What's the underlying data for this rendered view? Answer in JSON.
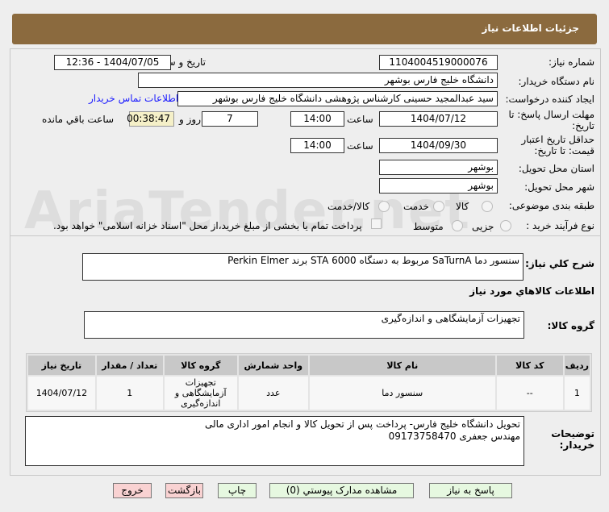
{
  "header": {
    "title": "جزئیات اطلاعات نیاز"
  },
  "form": {
    "need_number_label": "شماره نیاز:",
    "need_number": "1104004519000076",
    "announce_label": "تاریخ و ساعت اعلان عمومی:",
    "announce_value": "1404/07/05 - 12:36",
    "buyer_label": "نام دستگاه خریدار:",
    "buyer": "دانشگاه خلیج فارس بوشهر",
    "requester_label": "ایجاد کننده درخواست:",
    "requester": "سید عبدالمجید  حسینی کارشناس پژوهشی دانشگاه خلیج فارس بوشهر",
    "contact_link": "اطلاعات تماس خریدار",
    "deadline_label": "مهلت ارسال پاسخ: تا تاریخ:",
    "deadline_date": "1404/07/12",
    "time_label": "ساعت",
    "deadline_time": "14:00",
    "days": "7",
    "days_label": "روز و",
    "remaining": "00:38:47",
    "remaining_label": "ساعت باقي مانده",
    "validity_label": "حداقل تاریخ اعتبار قیمت: تا تاریخ:",
    "validity_date": "1404/09/30",
    "validity_time": "14:00",
    "province_label": "استان محل تحویل:",
    "province": "بوشهر",
    "city_label": "شهر محل تحویل:",
    "city": "بوشهر",
    "category_label": "طبقه بندی موضوعی:",
    "category_options": [
      "کالا",
      "خدمت",
      "کالا/خدمت"
    ],
    "process_label": "نوع فرآیند خرید :",
    "process_options": [
      "جزیی",
      "متوسط"
    ],
    "payment_note": "پرداخت تمام یا بخشی از مبلغ خرید،از محل \"اسناد خزانه اسلامی\" خواهد بود."
  },
  "description": {
    "label": "شرح كلي نياز:",
    "value": "سنسور دما SaTurnA مربوط به دستگاه STA 6000 برند Perkin Elmer"
  },
  "goods": {
    "section_title": "اطلاعات كالاهاي مورد نياز",
    "group_label": "گروه كالا:",
    "group_value": "تجهیزات آزمایشگاهی و اندازه‌گیری"
  },
  "table": {
    "headers": [
      "رديف",
      "كد كالا",
      "نام كالا",
      "واحد شمارش",
      "گروه كالا",
      "تعداد / مقدار",
      "تاريخ نياز"
    ],
    "rows": [
      [
        "1",
        "--",
        "سنسور دما",
        "عدد",
        "تجهیزات آزمایشگاهی و اندازه‌گیری",
        "1",
        "1404/07/12"
      ]
    ]
  },
  "notes": {
    "label": "توضیحات خریدار:",
    "line1": "تحویل دانشگاه خلیج فارس- پرداخت پس از تحویل کالا و انجام امور اداری مالی",
    "line2": "مهندس جعفری 09173758470"
  },
  "buttons": {
    "reply": "پاسخ به نیاز",
    "attachments": "مشاهده مدارک پیوستي (0)",
    "print": "چاپ",
    "back": "بازگشت",
    "exit": "خروج"
  },
  "watermark": "AriaTender.net"
}
